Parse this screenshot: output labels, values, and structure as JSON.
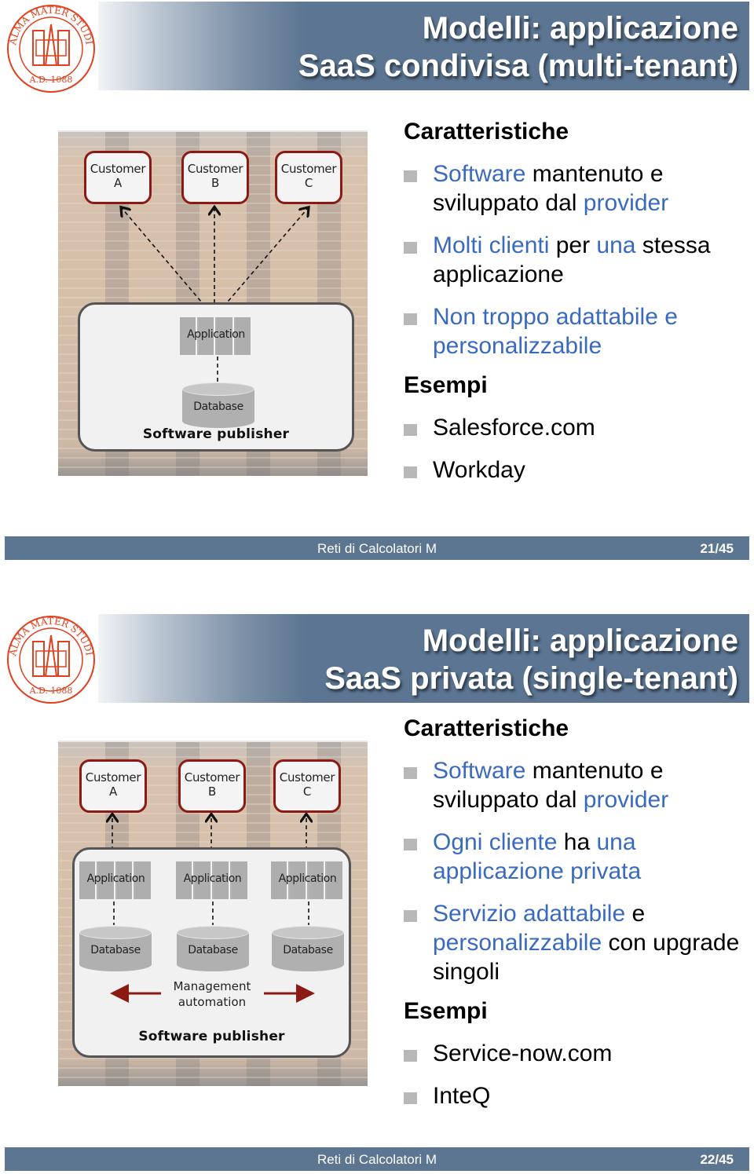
{
  "course": "Reti di Calcolatori M",
  "logo": {
    "icon": "university-seal-icon",
    "text_top": "ALMA MATER STUDIORUM",
    "text_bottom": "A.D. 1088",
    "color": "#e0401e"
  },
  "colors": {
    "titlebar": "#5b7592",
    "footer": "#5c7590",
    "accent_blue": "#3a6ac0",
    "customer_border": "#8b1a14",
    "bullet": "#b8b8b8"
  },
  "slides": [
    {
      "title_line1": "Modelli: applicazione",
      "title_line2": "SaaS condivisa (multi-tenant)",
      "diagram": {
        "customers": [
          {
            "line1": "Customer",
            "line2": "A"
          },
          {
            "line1": "Customer",
            "line2": "B"
          },
          {
            "line1": "Customer",
            "line2": "C"
          }
        ],
        "application_label": "Application",
        "database_label": "Database",
        "publisher_label": "Software publisher"
      },
      "heading_features": "Caratteristiche",
      "features": [
        [
          {
            "text": "Software",
            "blue": true
          },
          {
            "text": " mantenuto e sviluppato dal ",
            "blue": false
          },
          {
            "text": "provider",
            "blue": true
          }
        ],
        [
          {
            "text": "Molti clienti",
            "blue": true
          },
          {
            "text": " per ",
            "blue": false
          },
          {
            "text": "una",
            "blue": true
          },
          {
            "text": " stessa applicazione",
            "blue": false
          }
        ],
        [
          {
            "text": "Non troppo adattabile e personalizzabile",
            "blue": true
          }
        ]
      ],
      "heading_examples": "Esempi",
      "examples": [
        "Salesforce.com",
        "Workday"
      ],
      "page": "21/45"
    },
    {
      "title_line1": "Modelli: applicazione",
      "title_line2": "SaaS privata (single-tenant)",
      "diagram": {
        "customers": [
          {
            "line1": "Customer",
            "line2": "A"
          },
          {
            "line1": "Customer",
            "line2": "B"
          },
          {
            "line1": "Customer",
            "line2": "C"
          }
        ],
        "application_label": "Application",
        "database_label": "Database",
        "management_line1": "Management",
        "management_line2": "automation",
        "publisher_label": "Software publisher"
      },
      "heading_features": "Caratteristiche",
      "features": [
        [
          {
            "text": "Software",
            "blue": true
          },
          {
            "text": " mantenuto e sviluppato dal ",
            "blue": false
          },
          {
            "text": "provider",
            "blue": true
          }
        ],
        [
          {
            "text": "Ogni cliente",
            "blue": true
          },
          {
            "text": " ha ",
            "blue": false
          },
          {
            "text": "una applicazione privata",
            "blue": true
          }
        ],
        [
          {
            "text": "Servizio adattabile",
            "blue": true
          },
          {
            "text": " e ",
            "blue": false
          },
          {
            "text": "personalizzabile",
            "blue": true
          },
          {
            "text": " con upgrade singoli",
            "blue": false
          }
        ]
      ],
      "heading_examples": "Esempi",
      "examples": [
        "Service-now.com",
        "InteQ"
      ],
      "page": "22/45"
    }
  ]
}
